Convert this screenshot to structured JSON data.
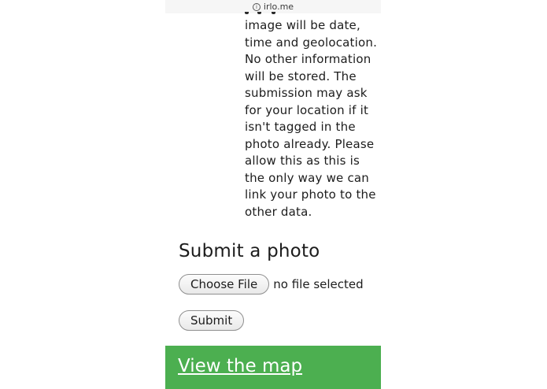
{
  "browser": {
    "url": "irlo.me"
  },
  "info": {
    "lines": [
      "image will be date,",
      "time and geolocation.",
      "No other information",
      "will be stored. The",
      "submission may ask",
      "for your location if it",
      "isn't tagged in the",
      "photo already. Please",
      "allow this as this is",
      "the only way we can",
      "link your photo to the",
      "other data."
    ]
  },
  "upload": {
    "title": "Submit a photo",
    "choose_label": "Choose File",
    "file_status": "no file selected",
    "submit_label": "Submit"
  },
  "footer": {
    "link": "View the map"
  },
  "colors": {
    "footer_bg": "#4caf50",
    "footer_text": "#ffffff"
  }
}
